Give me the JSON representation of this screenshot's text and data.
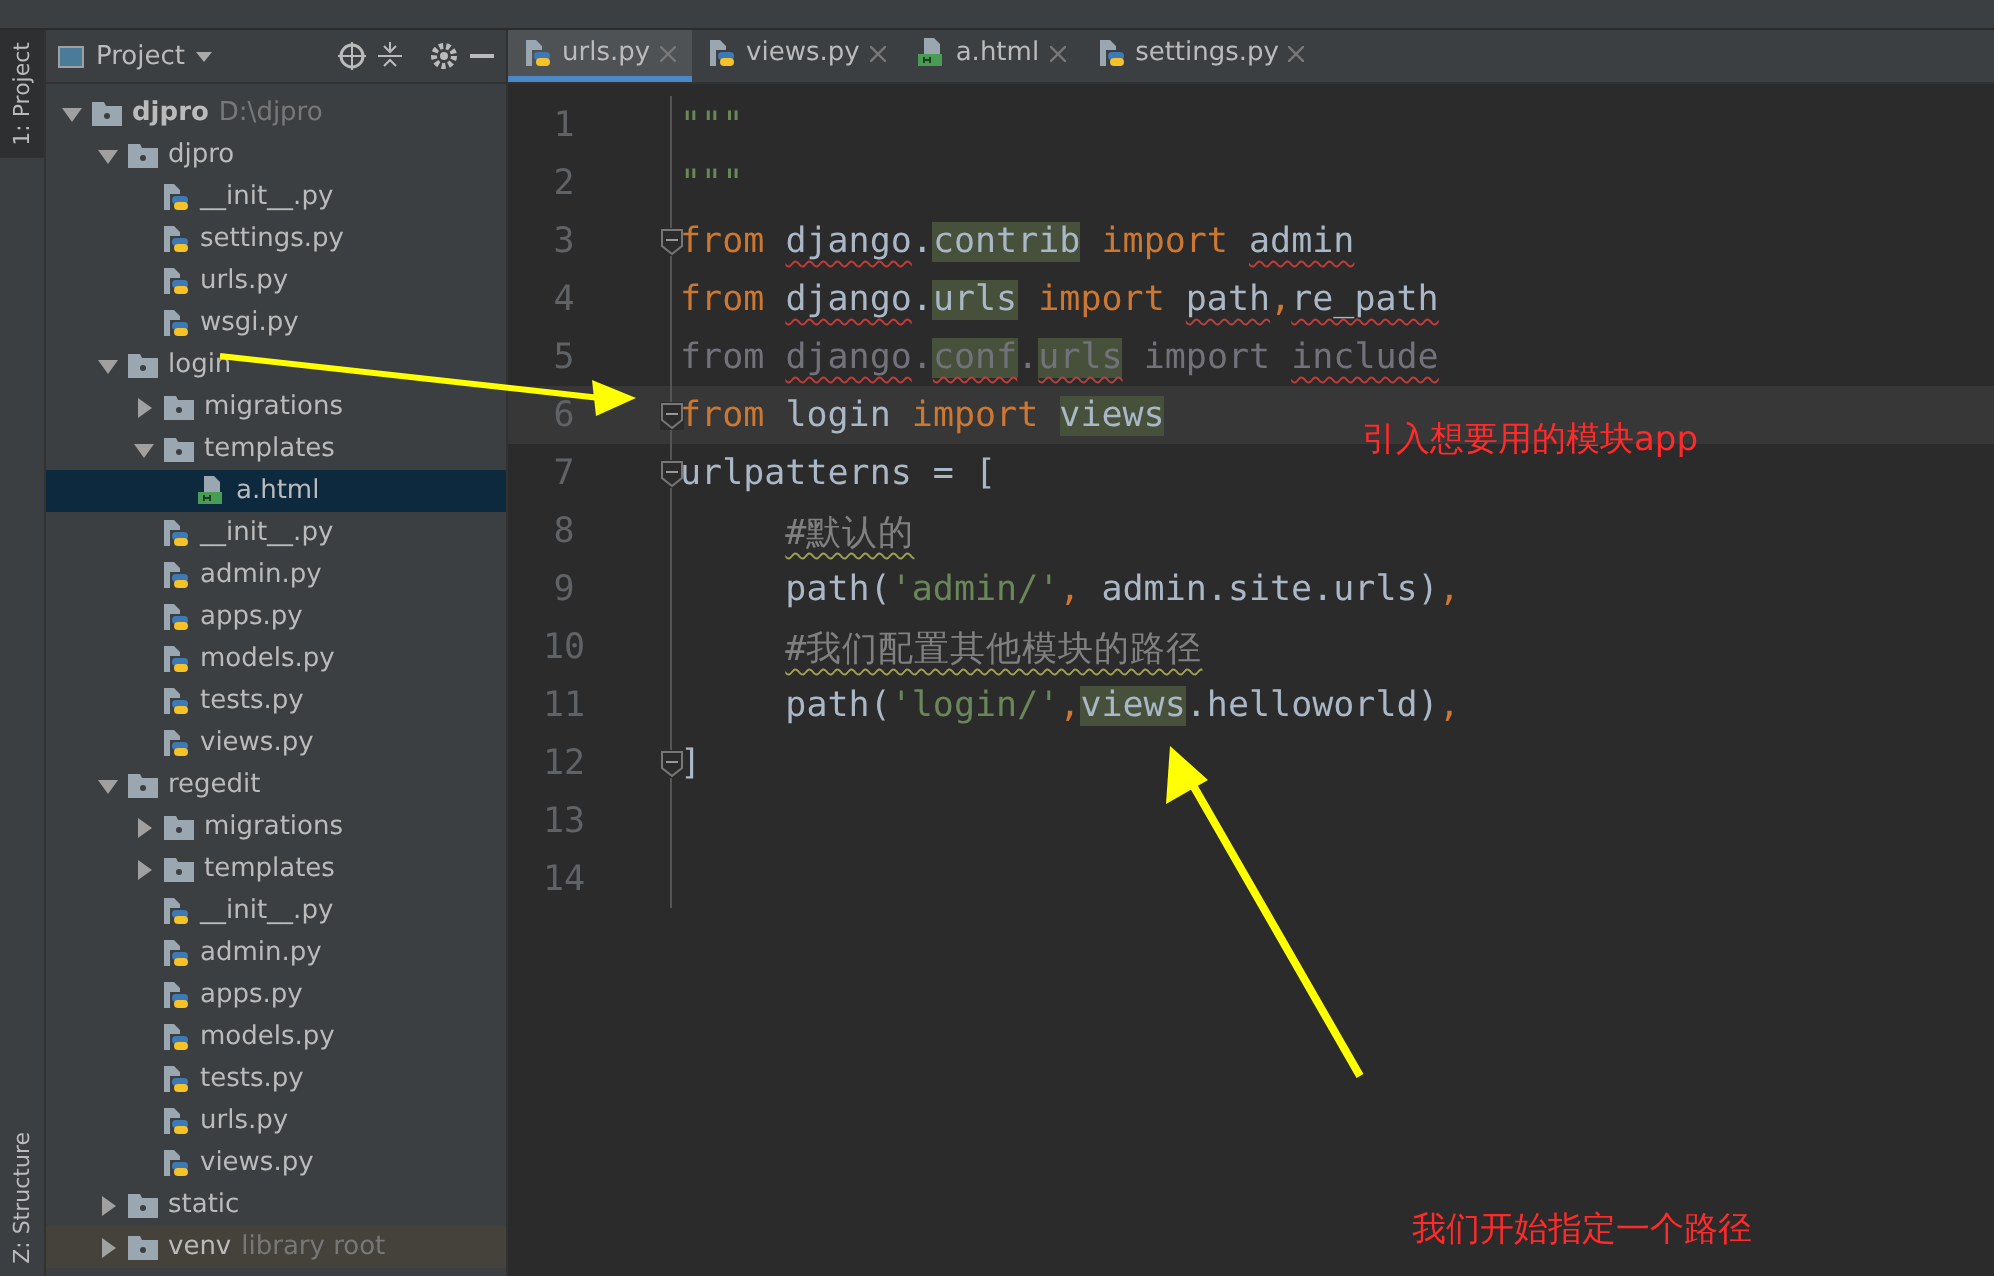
{
  "side_tabs": [
    {
      "label": "1: Project",
      "selected": true
    },
    {
      "label": "Z: Structure",
      "selected": false
    }
  ],
  "project_panel": {
    "title": "Project",
    "tree": [
      {
        "kind": "folder",
        "label": "djpro",
        "bold": true,
        "path": "D:\\djpro",
        "expanded": true,
        "selected": false,
        "children": [
          {
            "kind": "folder",
            "label": "djpro",
            "expanded": true,
            "selected": false,
            "children": [
              {
                "kind": "py",
                "label": "__init__.py",
                "selected": false
              },
              {
                "kind": "py",
                "label": "settings.py",
                "selected": false
              },
              {
                "kind": "py",
                "label": "urls.py",
                "selected": false
              },
              {
                "kind": "py",
                "label": "wsgi.py",
                "selected": false
              }
            ]
          },
          {
            "kind": "folder",
            "label": "login",
            "expanded": true,
            "selected": false,
            "children": [
              {
                "kind": "folder",
                "label": "migrations",
                "expanded": false,
                "selected": false
              },
              {
                "kind": "folder",
                "label": "templates",
                "expanded": true,
                "selected": false,
                "children": [
                  {
                    "kind": "html",
                    "label": "a.html",
                    "selected": true
                  }
                ]
              },
              {
                "kind": "py",
                "label": "__init__.py",
                "selected": false
              },
              {
                "kind": "py",
                "label": "admin.py",
                "selected": false
              },
              {
                "kind": "py",
                "label": "apps.py",
                "selected": false
              },
              {
                "kind": "py",
                "label": "models.py",
                "selected": false
              },
              {
                "kind": "py",
                "label": "tests.py",
                "selected": false
              },
              {
                "kind": "py",
                "label": "views.py",
                "selected": false
              }
            ]
          },
          {
            "kind": "folder",
            "label": "regedit",
            "expanded": true,
            "selected": false,
            "children": [
              {
                "kind": "folder",
                "label": "migrations",
                "expanded": false,
                "selected": false
              },
              {
                "kind": "folder",
                "label": "templates",
                "expanded": false,
                "selected": false
              },
              {
                "kind": "py",
                "label": "__init__.py",
                "selected": false
              },
              {
                "kind": "py",
                "label": "admin.py",
                "selected": false
              },
              {
                "kind": "py",
                "label": "apps.py",
                "selected": false
              },
              {
                "kind": "py",
                "label": "models.py",
                "selected": false
              },
              {
                "kind": "py",
                "label": "tests.py",
                "selected": false
              },
              {
                "kind": "py",
                "label": "urls.py",
                "selected": false
              },
              {
                "kind": "py",
                "label": "views.py",
                "selected": false
              }
            ]
          },
          {
            "kind": "folder",
            "label": "static",
            "expanded": false,
            "selected": false
          },
          {
            "kind": "folder",
            "label": "venv",
            "note": "library root",
            "expanded": false,
            "selected": false
          }
        ]
      }
    ]
  },
  "editor": {
    "tabs": [
      {
        "kind": "py",
        "label": "urls.py",
        "selected": true
      },
      {
        "kind": "py",
        "label": "views.py",
        "selected": false
      },
      {
        "kind": "html",
        "label": "a.html",
        "selected": false
      },
      {
        "kind": "py",
        "label": "settings.py",
        "selected": false
      }
    ],
    "lines": [
      {
        "number": "1",
        "current": false,
        "fold": false,
        "indent": false,
        "tokens": [
          {
            "kind": "str",
            "text": "\"\"\""
          }
        ]
      },
      {
        "number": "2",
        "current": false,
        "fold": false,
        "indent": false,
        "tokens": [
          {
            "kind": "str",
            "text": "\"\"\""
          }
        ]
      },
      {
        "number": "3",
        "current": false,
        "fold": true,
        "indent": false,
        "tokens": [
          {
            "kind": "kw",
            "text": "from"
          },
          {
            "kind": "id",
            "text": "django",
            "gap": true,
            "warn": true
          },
          {
            "kind": "id",
            "text": "."
          },
          {
            "kind": "id",
            "text": "contrib",
            "marked": true
          },
          {
            "kind": "kw",
            "text": "import",
            "gap": true
          },
          {
            "kind": "id",
            "text": "admin",
            "gap": true,
            "warn": true
          }
        ]
      },
      {
        "number": "4",
        "current": false,
        "fold": false,
        "indent": false,
        "tokens": [
          {
            "kind": "kw",
            "text": "from"
          },
          {
            "kind": "id",
            "text": "django",
            "gap": true,
            "warn": true
          },
          {
            "kind": "id",
            "text": "."
          },
          {
            "kind": "id",
            "text": "urls",
            "marked": true
          },
          {
            "kind": "kw",
            "text": "import",
            "gap": true
          },
          {
            "kind": "id",
            "text": "path",
            "gap": true,
            "warn": true
          },
          {
            "kind": "punct",
            "text": ","
          },
          {
            "kind": "id",
            "text": "re_path",
            "warn": true
          }
        ]
      },
      {
        "number": "5",
        "current": false,
        "fold": false,
        "indent": false,
        "tokens": [
          {
            "kind": "dim",
            "text": "from"
          },
          {
            "kind": "dim",
            "text": "django",
            "gap": true,
            "warn": true
          },
          {
            "kind": "dim",
            "text": "."
          },
          {
            "kind": "dim",
            "text": "conf",
            "marked": true,
            "warn": true
          },
          {
            "kind": "dim",
            "text": "."
          },
          {
            "kind": "dim",
            "text": "urls",
            "marked": true,
            "warn": true
          },
          {
            "kind": "dim",
            "text": "import",
            "gap": true
          },
          {
            "kind": "dim",
            "text": "include",
            "gap": true,
            "warn": true
          }
        ]
      },
      {
        "number": "6",
        "current": true,
        "fold": true,
        "indent": false,
        "tokens": [
          {
            "kind": "kw",
            "text": "from"
          },
          {
            "kind": "id",
            "text": "login",
            "gap": true
          },
          {
            "kind": "kw",
            "text": "import",
            "gap": true
          },
          {
            "kind": "id",
            "text": "views",
            "gap": true,
            "marked": true
          }
        ]
      },
      {
        "number": "7",
        "current": false,
        "fold": true,
        "indent": false,
        "tokens": [
          {
            "kind": "id",
            "text": "urlpatterns = ["
          }
        ]
      },
      {
        "number": "8",
        "current": false,
        "fold": false,
        "indent": true,
        "tokens": [
          {
            "kind": "comment",
            "text": "#默认的",
            "typo": true
          }
        ]
      },
      {
        "number": "9",
        "current": false,
        "fold": false,
        "indent": true,
        "tokens": [
          {
            "kind": "id",
            "text": "path("
          },
          {
            "kind": "str",
            "text": "'admin/'"
          },
          {
            "kind": "punct",
            "text": ","
          },
          {
            "kind": "id",
            "text": "admin.site.urls)",
            "gap": true
          },
          {
            "kind": "punct",
            "text": ","
          }
        ]
      },
      {
        "number": "10",
        "current": false,
        "fold": false,
        "indent": true,
        "tokens": [
          {
            "kind": "comment",
            "text": "#我们配置其他模块的路径",
            "typo": true
          }
        ]
      },
      {
        "number": "11",
        "current": false,
        "fold": false,
        "indent": true,
        "tokens": [
          {
            "kind": "id",
            "text": "path("
          },
          {
            "kind": "str",
            "text": "'login/'"
          },
          {
            "kind": "punct",
            "text": ","
          },
          {
            "kind": "id",
            "text": "views",
            "marked": true
          },
          {
            "kind": "id",
            "text": ".helloworld)"
          },
          {
            "kind": "punct",
            "text": ","
          }
        ]
      },
      {
        "number": "12",
        "current": false,
        "fold": true,
        "indent": false,
        "tokens": [
          {
            "kind": "id",
            "text": "]"
          }
        ]
      },
      {
        "number": "13",
        "current": false,
        "fold": false
      },
      {
        "number": "14",
        "current": false,
        "fold": false
      }
    ]
  },
  "annotations": [
    {
      "text": "引入想要用的模块app"
    },
    {
      "text": "我们开始指定一个路径"
    }
  ]
}
